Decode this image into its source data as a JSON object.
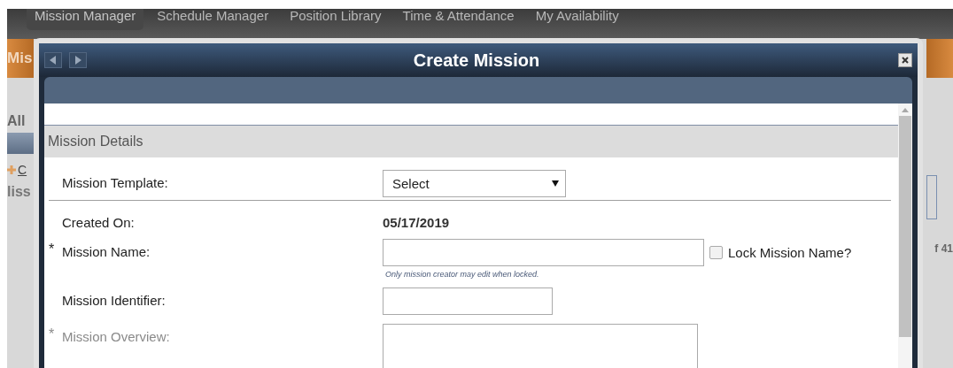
{
  "nav": {
    "tabs": [
      {
        "label": "Mission Manager",
        "selected": true
      },
      {
        "label": "Schedule Manager",
        "selected": false
      },
      {
        "label": "Position Library",
        "selected": false
      },
      {
        "label": "Time & Attendance",
        "selected": false
      },
      {
        "label": "My Availability",
        "selected": false
      }
    ]
  },
  "background": {
    "banner_title": "Mis",
    "filter_label": "All",
    "add_link": "C",
    "section_label": "liss",
    "pager_text": "f 41"
  },
  "dialog": {
    "title": "Create Mission",
    "section": "Mission Details",
    "fields": [
      {
        "kind": "select",
        "label": "Mission Template:",
        "disabled": false,
        "value": "Select"
      },
      {
        "kind": "static",
        "label": "Created On:",
        "disabled": false,
        "value": "05/17/2019"
      },
      {
        "kind": "text",
        "label": "Mission Name:",
        "marker": "*",
        "disabled": false,
        "checkbox": {
          "label": "Lock Mission Name?",
          "checked": false
        },
        "hint": "Only mission creator may edit when locked."
      },
      {
        "kind": "text",
        "label": "Mission Identifier:",
        "disabled": false
      },
      {
        "kind": "textarea",
        "label": "Mission Overview:",
        "marker": "*",
        "disabled": true
      }
    ]
  }
}
